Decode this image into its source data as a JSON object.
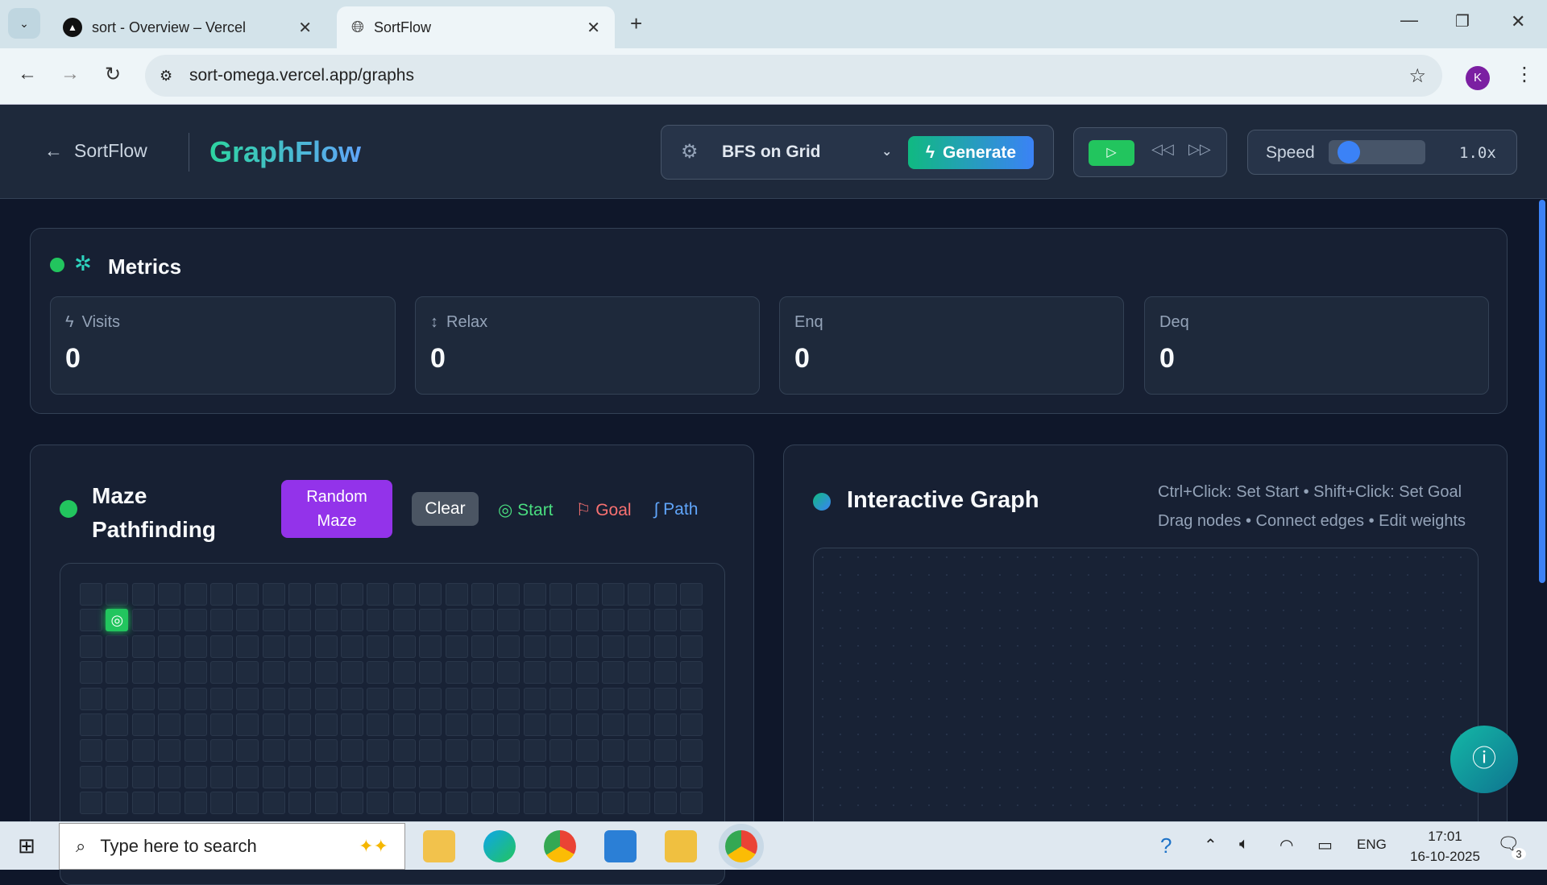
{
  "browser": {
    "tabs": [
      {
        "title": "sort - Overview – Vercel"
      },
      {
        "title": "SortFlow"
      }
    ],
    "url": "sort-omega.vercel.app/graphs",
    "profile_initial": "K"
  },
  "header": {
    "back_label": "SortFlow",
    "title": "GraphFlow",
    "algorithm": "BFS on Grid",
    "generate_label": "Generate",
    "speed_label": "Speed",
    "speed_value": "1.0x",
    "speed_fraction": 0.1
  },
  "metrics": {
    "title": "Metrics",
    "items": [
      {
        "label": "Visits",
        "value": "0"
      },
      {
        "label": "Relax",
        "value": "0"
      },
      {
        "label": "Enq",
        "value": "0"
      },
      {
        "label": "Deq",
        "value": "0"
      }
    ]
  },
  "maze": {
    "title_line1": "Maze",
    "title_line2": "Pathfinding",
    "random_line1": "Random",
    "random_line2": "Maze",
    "clear_label": "Clear",
    "legend": {
      "start": "Start",
      "goal": "Goal",
      "path": "Path"
    },
    "cols": 24,
    "rows": 9,
    "start": {
      "row": 1,
      "col": 1
    }
  },
  "graph": {
    "title": "Interactive Graph",
    "hint1": "Ctrl+Click: Set Start • Shift+Click: Set Goal",
    "hint2": "Drag nodes • Connect edges • Edit weights"
  },
  "taskbar": {
    "search_placeholder": "Type here to search",
    "lang": "ENG",
    "time": "17:01",
    "date": "16-10-2025",
    "notif_count": "3"
  },
  "colors": {
    "accent_green": "#22c55e",
    "accent_blue": "#3b82f6",
    "purple": "#9333ea",
    "goal_red": "#f87171"
  }
}
